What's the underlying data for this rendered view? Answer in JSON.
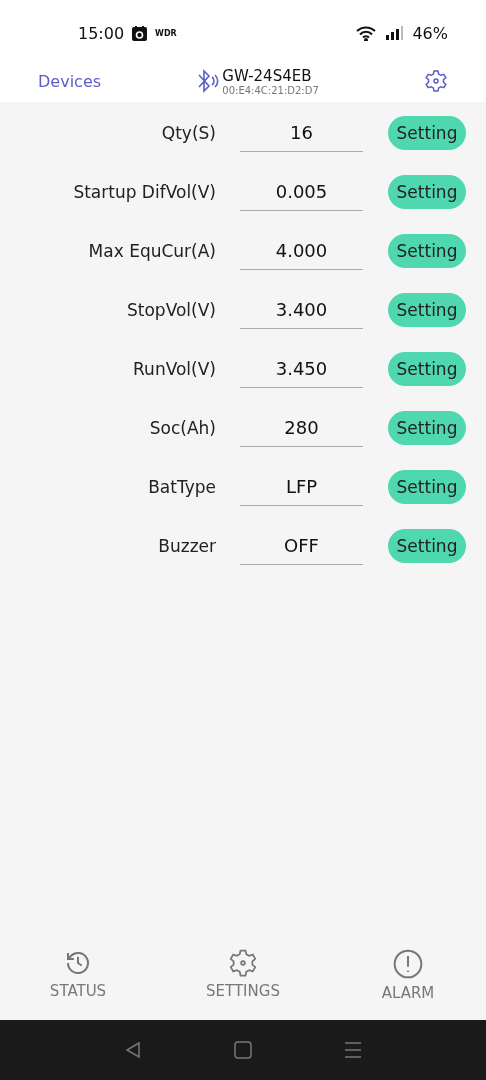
{
  "status_bar": {
    "time": "15:00",
    "badge": "WDR",
    "battery": "46%"
  },
  "header": {
    "back_link": "Devices",
    "device_name": "GW-24S4EB",
    "device_address": "00:E4:4C:21:D2:D7"
  },
  "settings": [
    {
      "label": "Qty(S)",
      "value": "16",
      "button": "Setting"
    },
    {
      "label": "Startup DifVol(V)",
      "value": "0.005",
      "button": "Setting"
    },
    {
      "label": "Max EquCur(A)",
      "value": "4.000",
      "button": "Setting"
    },
    {
      "label": "StopVol(V)",
      "value": "3.400",
      "button": "Setting"
    },
    {
      "label": "RunVol(V)",
      "value": "3.450",
      "button": "Setting"
    },
    {
      "label": "Soc(Ah)",
      "value": "280",
      "button": "Setting"
    },
    {
      "label": "BatType",
      "value": "LFP",
      "button": "Setting"
    },
    {
      "label": "Buzzer",
      "value": "OFF",
      "button": "Setting"
    }
  ],
  "bottom_nav": [
    {
      "kind": "history",
      "label": "STATUS"
    },
    {
      "kind": "settings",
      "label": "SETTINGS"
    },
    {
      "kind": "alarm",
      "label": "ALARM"
    }
  ]
}
